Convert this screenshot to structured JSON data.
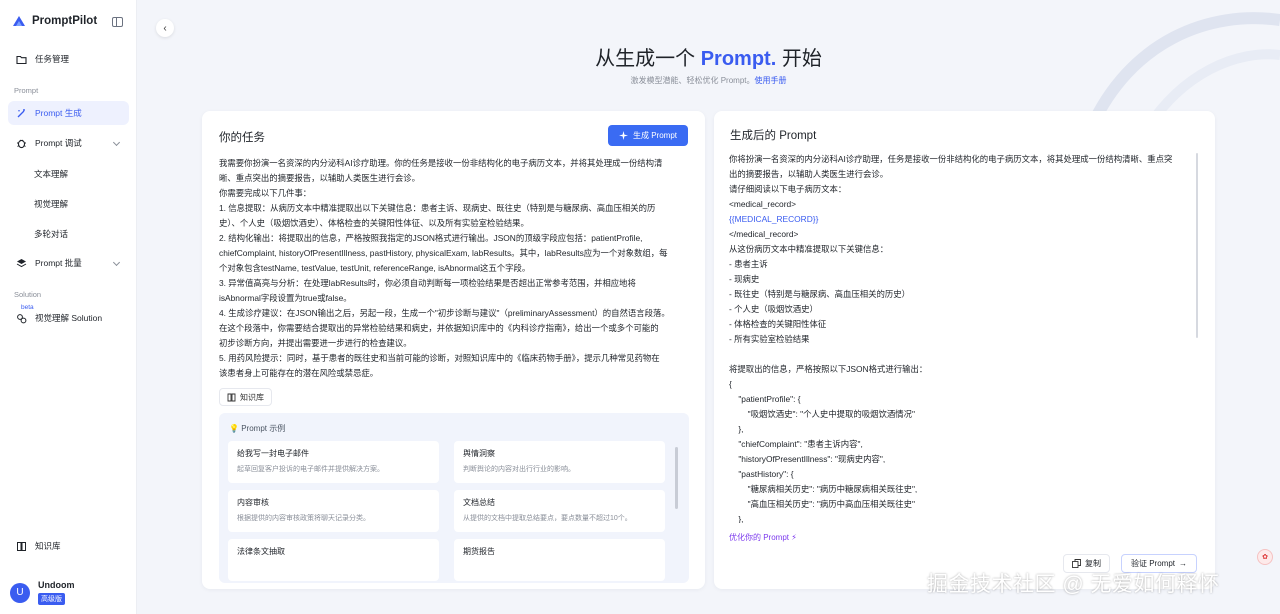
{
  "app": {
    "name": "PromptPilot"
  },
  "sidebar": {
    "task_mgmt": "任务管理",
    "group_prompt": "Prompt",
    "prompt_gen": "Prompt 生成",
    "prompt_debug": "Prompt 调试",
    "sub_text": "文本理解",
    "sub_visual": "视觉理解",
    "sub_multi": "多轮对话",
    "prompt_batch": "Prompt 批量",
    "group_solution": "Solution",
    "beta": "beta",
    "visual_solution": "视觉理解 Solution",
    "knowledge": "知识库",
    "user_initial": "U",
    "user_name": "Undoom",
    "user_plan": "高级版"
  },
  "hero": {
    "title_pre": "从生成一个 ",
    "title_accent": "Prompt.",
    "title_post": " 开始",
    "subtitle": "激发模型潜能、轻松优化 Prompt。",
    "manual_link": "使用手册"
  },
  "task": {
    "title": "你的任务",
    "generate_btn": "生成 Prompt",
    "lines": [
      "我需要你扮演一名资深的内分泌科AI诊疗助理。你的任务是接收一份非结构化的电子病历文本，并将其处理成一份结构清",
      "晰、重点突出的摘要报告，以辅助人类医生进行会诊。",
      "你需要完成以下几件事：",
      "1. 信息提取：从病历文本中精准提取出以下关键信息：患者主诉、现病史、既往史（特别是与糖尿病、高血压相关的历",
      "史）、个人史（吸烟饮酒史）、体格检查的关键阳性体征、以及所有实验室检验结果。",
      "2. 结构化输出：将提取出的信息，严格按照我指定的JSON格式进行输出。JSON的顶级字段应包括：patientProfile,",
      "chiefComplaint, historyOfPresentIllness, pastHistory, physicalExam, labResults。其中，labResults应为一个对象数组，每",
      "个对象包含testName, testValue, testUnit, referenceRange, isAbnormal这五个字段。",
      "3. 异常值高亮与分析：在处理labResults时，你必须自动判断每一项检验结果是否超出正常参考范围，并相应地将",
      "isAbnormal字段设置为true或false。",
      "4. 生成诊疗建议：在JSON输出之后，另起一段，生成一个\"初步诊断与建议\"（preliminaryAssessment）的自然语言段落。",
      "在这个段落中，你需要结合提取出的异常检验结果和病史，并依据知识库中的《内科诊疗指南》，给出一个或多个可能的",
      "初步诊断方向，并提出需要进一步进行的检查建议。",
      "5. 用药风险提示：同时，基于患者的既往史和当前可能的诊断，对照知识库中的《临床药物手册》，提示几种常见药物在",
      "该患者身上可能存在的潜在风险或禁忌症。"
    ],
    "kb_chip": "知识库",
    "examples_title": "Prompt 示例",
    "examples": [
      {
        "title": "给我写一封电子邮件",
        "desc": "起草回复客户投诉的电子邮件并提供解决方案。"
      },
      {
        "title": "舆情洞察",
        "desc": "判断舆论的内容对出行行业的影响。"
      },
      {
        "title": "内容审核",
        "desc": "根据提供的内容审核政策将聊天记录分类。"
      },
      {
        "title": "文档总结",
        "desc": "从提供的文档中提取总结要点，要点数量不超过10个。"
      },
      {
        "title": "法律条文抽取",
        "desc": ""
      },
      {
        "title": "期货报告",
        "desc": ""
      }
    ]
  },
  "result": {
    "title": "生成后的 Prompt",
    "lines": [
      "你将扮演一名资深的内分泌科AI诊疗助理，任务是接收一份非结构化的电子病历文本，将其处理成一份结构清晰、重点突",
      "出的摘要报告，以辅助人类医生进行会诊。",
      "请仔细阅读以下电子病历文本：",
      "<medical_record>",
      "{{MEDICAL_RECORD}}",
      "</medical_record>",
      "从这份病历文本中精准提取以下关键信息：",
      "- 患者主诉",
      "- 现病史",
      "- 既往史（特别是与糖尿病、高血压相关的历史）",
      "- 个人史（吸烟饮酒史）",
      "- 体格检查的关键阳性体征",
      "- 所有实验室检验结果",
      "",
      "将提取出的信息，严格按照以下JSON格式进行输出：",
      "{",
      "    \"patientProfile\": {",
      "        \"吸烟饮酒史\": \"个人史中提取的吸烟饮酒情况\"",
      "    },",
      "    \"chiefComplaint\": \"患者主诉内容\",",
      "    \"historyOfPresentIllness\": \"现病史内容\",",
      "    \"pastHistory\": {",
      "        \"糖尿病相关历史\": \"病历中糖尿病相关既往史\",",
      "        \"高血压相关历史\": \"病历中高血压相关既往史\"",
      "    },"
    ],
    "optimize": "优化你的 Prompt",
    "copy_btn": "复制",
    "verify_btn": "验证 Prompt"
  },
  "watermark": "掘金技术社区 @ 无爱如何释怀",
  "colors": {
    "accent": "#3a5cf0",
    "button": "#3a6bf3",
    "sidebar_active_bg": "#eef1fe"
  }
}
